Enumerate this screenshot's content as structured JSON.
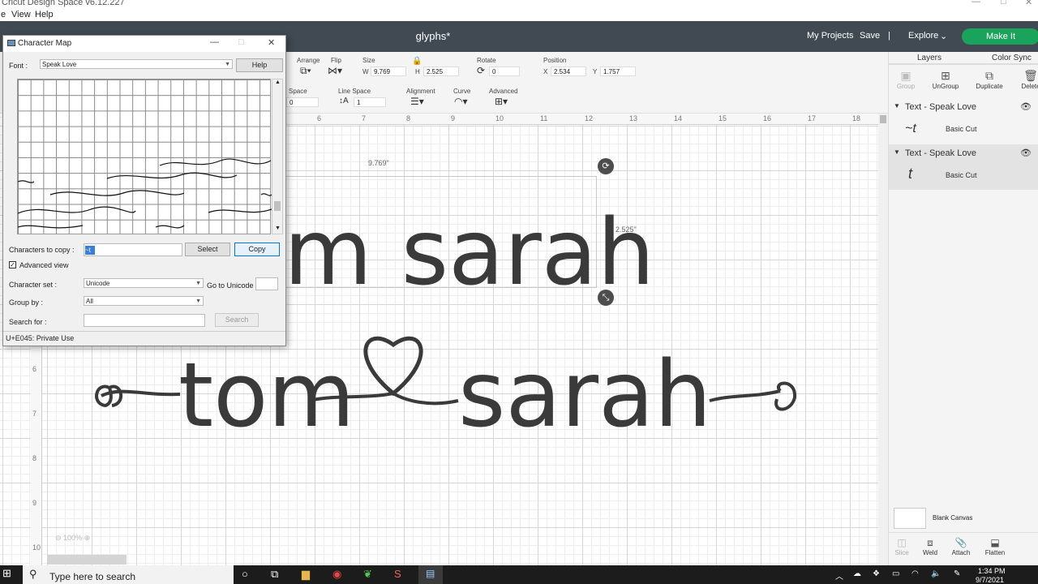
{
  "os": {
    "window_title": "Cricut Design Space  v6.12.227",
    "menu": [
      "e",
      "View",
      "Help"
    ]
  },
  "header": {
    "project_title": "glyphs*",
    "my_projects": "My Projects",
    "save": "Save",
    "separator": "|",
    "explore": "Explore",
    "make_it": "Make It"
  },
  "toolbar": {
    "arrange": "Arrange",
    "flip": "Flip",
    "size": "Size",
    "w_label": "W",
    "w_value": "9.769",
    "h_label": "H",
    "h_value": "2.525",
    "rotate": "Rotate",
    "rotate_value": "0",
    "position": "Position",
    "x_label": "X",
    "x_value": "2.534",
    "y_label": "Y",
    "y_value": "1.757",
    "letter_space": "Space",
    "letter_space_value": "0",
    "line_space": "Line Space",
    "line_space_value": "1",
    "alignment": "Alignment",
    "curve": "Curve",
    "advanced": "Advanced"
  },
  "canvas": {
    "ruler_h": [
      "6",
      "7",
      "8",
      "9",
      "10",
      "11",
      "12",
      "13",
      "14",
      "15",
      "16",
      "17",
      "18"
    ],
    "ruler_v": [
      "6",
      "7",
      "8",
      "9",
      "10"
    ],
    "width_label": "9.769\"",
    "height_label": "2.525\"",
    "upper_text": "m sarah",
    "lower_left": "tom",
    "lower_right": "sarah",
    "zoom": "100%"
  },
  "layers_panel": {
    "tab_layers": "Layers",
    "tab_color_sync": "Color Sync",
    "actions": [
      "Group",
      "UnGroup",
      "Duplicate",
      "Delete"
    ],
    "layers": [
      {
        "title": "Text - Speak Love",
        "item": "Basic Cut"
      },
      {
        "title": "Text - Speak Love",
        "item": "Basic Cut"
      }
    ],
    "blank_canvas": "Blank Canvas",
    "bottom_actions": [
      "Slice",
      "Weld",
      "Attach",
      "Flatten"
    ]
  },
  "charmap": {
    "title": "Character Map",
    "font_label": "Font :",
    "font_value": "Speak Love",
    "help": "Help",
    "chars_to_copy_label": "Characters to copy :",
    "select": "Select",
    "copy": "Copy",
    "advanced_view": "Advanced view",
    "charset_label": "Character set :",
    "charset_value": "Unicode",
    "goto_unicode": "Go to Unicode",
    "group_by_label": "Group by :",
    "group_by_value": "All",
    "search_for_label": "Search for :",
    "search_button": "Search",
    "status": "U+E045: Private Use"
  },
  "taskbar": {
    "search_placeholder": "Type here to search",
    "time": "1:34 PM",
    "date": "9/7/2021"
  }
}
